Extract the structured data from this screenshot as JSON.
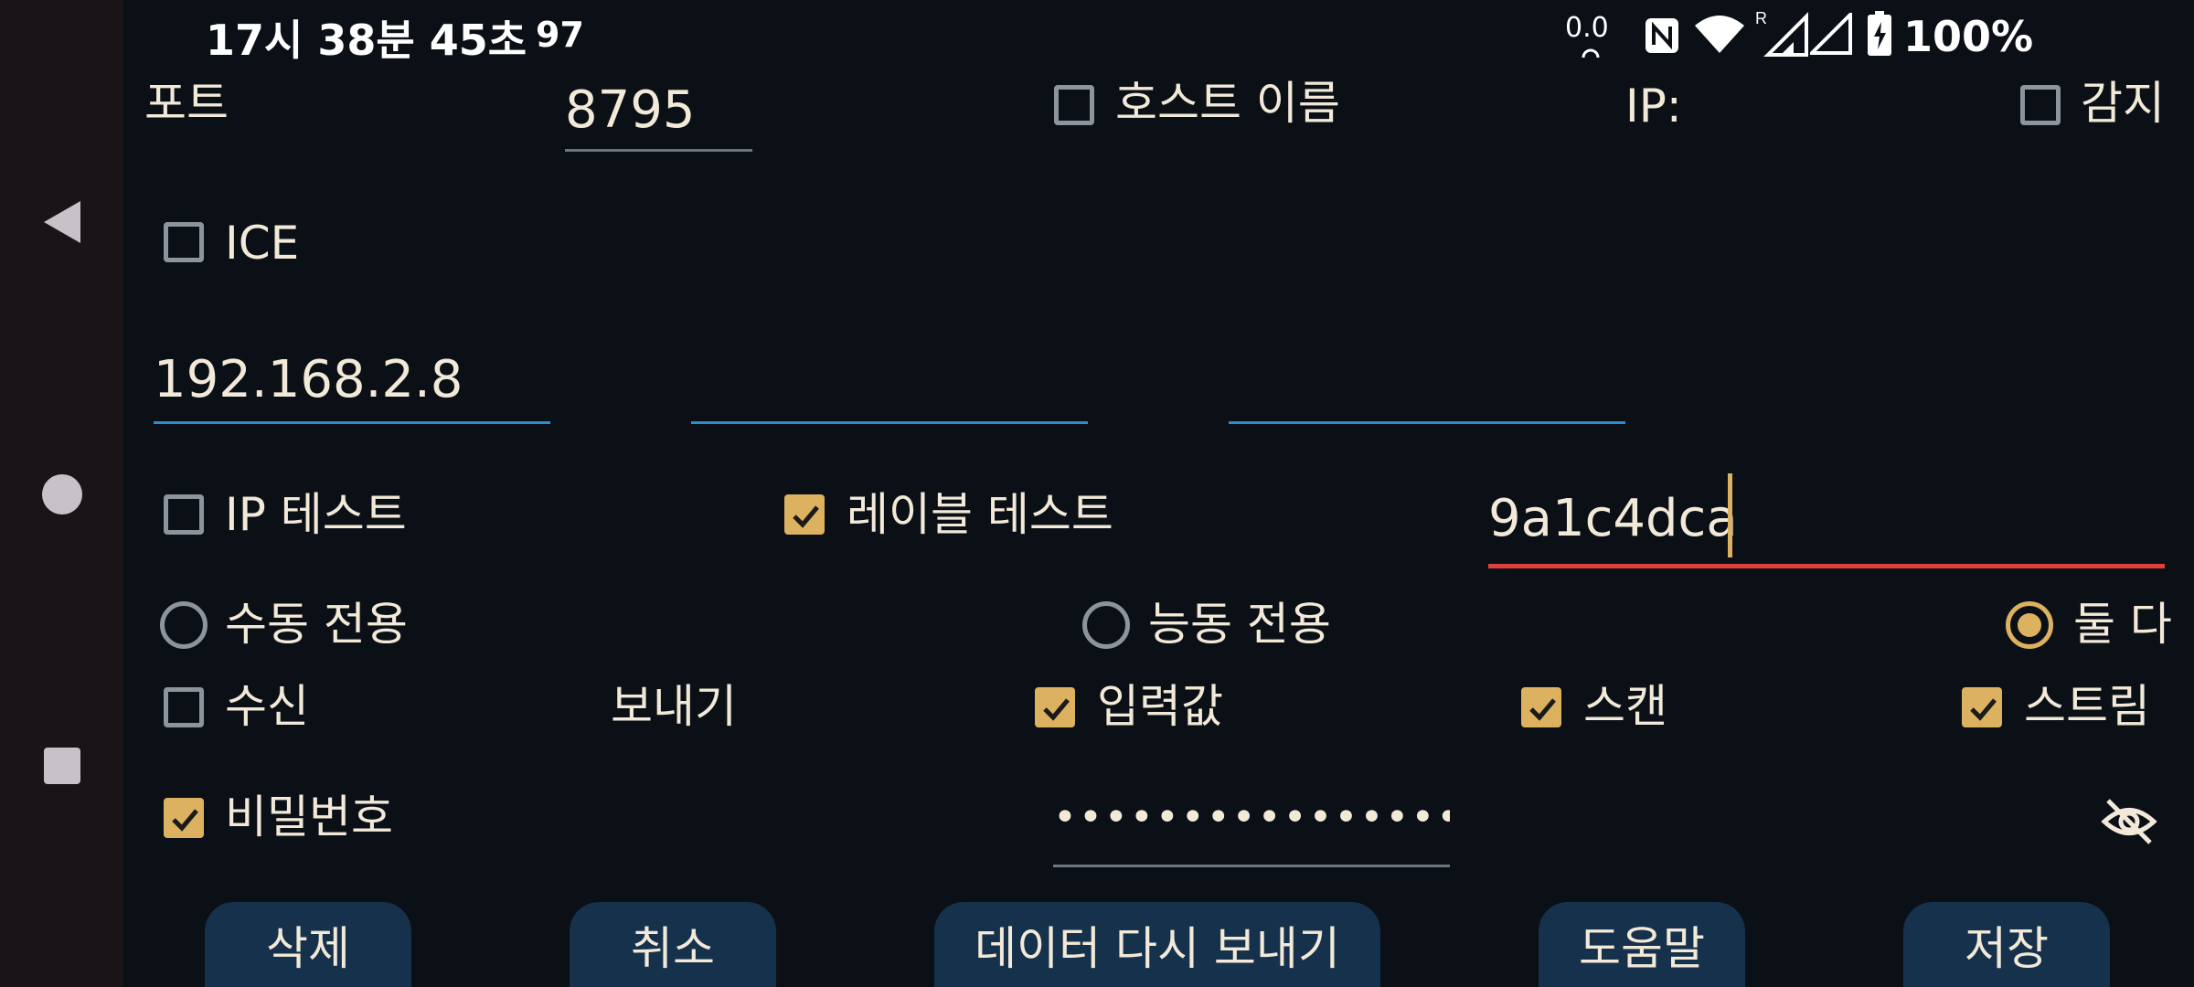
{
  "status_bar": {
    "time": "17시 38분 45초",
    "extra": "97",
    "sensor": "0.0",
    "battery": "100%"
  },
  "form": {
    "port_label": "포트",
    "port_value": "8795",
    "hostname_label": "호스트 이름",
    "ip_label": "IP:",
    "detect_label": "감지",
    "ice_label": "ICE",
    "ip_field_1": "192.168.2.8",
    "ip_field_2": "",
    "ip_field_3": "",
    "ip_test_label": "IP 테스트",
    "relay_test_label": "레이블 테스트",
    "relay_code": "9a1c4dca",
    "mode_manual": "수동 전용",
    "mode_active": "능동 전용",
    "mode_both": "둘 다",
    "receive_label": "수신",
    "send_label": "보내기",
    "input_label": "입력값",
    "scan_label": "스캔",
    "stream_label": "스트림",
    "password_label": "비밀번호",
    "password_value": "••••••••••••••••"
  },
  "buttons": {
    "delete": "삭제",
    "cancel": "취소",
    "resend": "데이터 다시 보내기",
    "help": "도움말",
    "save": "저장"
  },
  "colors": {
    "background": "#0b1017",
    "accent": "#dcb15f",
    "field_underline": "#2a8fd0",
    "error_underline": "#e0403d",
    "button_bg": "#15314b"
  }
}
